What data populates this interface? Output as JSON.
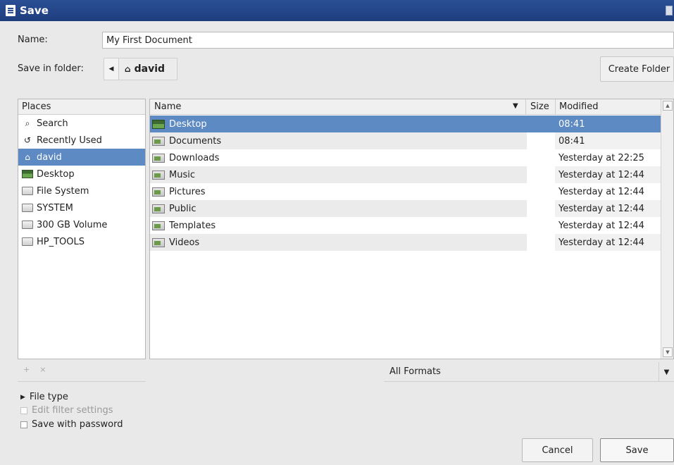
{
  "window": {
    "title": "Save"
  },
  "name_row": {
    "label": "Name:",
    "value": "My First Document"
  },
  "folder_row": {
    "label": "Save in folder:",
    "crumb": "david"
  },
  "create_folder_label": "Create Folder",
  "places": {
    "header": "Places",
    "items": [
      {
        "label": "Search",
        "icon": "search-icon"
      },
      {
        "label": "Recently Used",
        "icon": "recent-icon"
      },
      {
        "label": "david",
        "icon": "home-icon",
        "selected": true
      },
      {
        "label": "Desktop",
        "icon": "desktop-icon"
      },
      {
        "label": "File System",
        "icon": "drive-icon"
      },
      {
        "label": "SYSTEM",
        "icon": "drive-icon"
      },
      {
        "label": "300 GB Volume",
        "icon": "drive-icon"
      },
      {
        "label": "HP_TOOLS",
        "icon": "drive-icon"
      }
    ],
    "tools": [
      "+",
      "×"
    ]
  },
  "files": {
    "columns": {
      "name": "Name",
      "size": "Size",
      "modified": "Modified"
    },
    "rows": [
      {
        "name": "Desktop",
        "modified": "08:41",
        "selected": true,
        "icon": "desktop-folder-icon"
      },
      {
        "name": "Documents",
        "modified": "08:41",
        "icon": "folder-icon"
      },
      {
        "name": "Downloads",
        "modified": "Yesterday at 22:25",
        "icon": "folder-icon"
      },
      {
        "name": "Music",
        "modified": "Yesterday at 12:44",
        "icon": "folder-icon"
      },
      {
        "name": "Pictures",
        "modified": "Yesterday at 12:44",
        "icon": "folder-icon"
      },
      {
        "name": "Public",
        "modified": "Yesterday at 12:44",
        "icon": "folder-icon"
      },
      {
        "name": "Templates",
        "modified": "Yesterday at 12:44",
        "icon": "folder-icon"
      },
      {
        "name": "Videos",
        "modified": "Yesterday at 12:44",
        "icon": "folder-icon"
      }
    ]
  },
  "format_filter": {
    "selected": "All Formats"
  },
  "options": {
    "file_type": "File type",
    "edit_filter": "Edit filter settings",
    "save_with_password": "Save with password"
  },
  "buttons": {
    "cancel": "Cancel",
    "save": "Save"
  }
}
